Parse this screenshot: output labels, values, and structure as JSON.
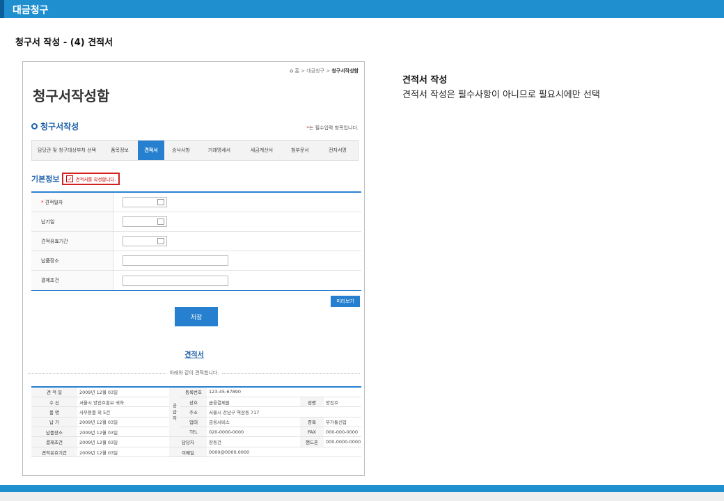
{
  "header": {
    "title": "대금청구"
  },
  "section_title": "청구서 작성 - (4) 견적서",
  "frame": {
    "breadcrumb": {
      "home": "홈",
      "sep": ">",
      "mid": "대금청구",
      "current": "청구서작성함"
    },
    "page_title": "청구서작성함",
    "sub_title": "청구서작성",
    "required_note_star": "*",
    "required_note": "는 필수입력 항목입니다.",
    "tabs": [
      {
        "label": "담당관 및 청구대상부처 선택"
      },
      {
        "label": "품목정보"
      },
      {
        "label": "견적서",
        "active": true
      },
      {
        "label": "승낙사항"
      },
      {
        "label": "거래명세서"
      },
      {
        "label": "세금계산서"
      },
      {
        "label": "첨부문서"
      },
      {
        "label": "전자서명"
      }
    ],
    "basic_info": {
      "label": "기본정보",
      "checkbox_mark": "✓",
      "checkbox_label": "견적서를 작성합니다."
    },
    "form": {
      "rows": [
        {
          "label": "견적일자",
          "required": true
        },
        {
          "label": "납기일"
        },
        {
          "label": "견적유효기간"
        },
        {
          "label": "납품장소"
        },
        {
          "label": "결제조건"
        }
      ]
    },
    "preview_button": "미리보기",
    "save_button": "저장",
    "estimate": {
      "title": "견적서",
      "subtitle": "아래와 같이 견적합니다.",
      "supplier_label": "공급자",
      "rows": [
        {
          "k1": "견 적 일",
          "v1": "2009년 12월 03일",
          "k2": "등록번호",
          "v2": "123-45-67890",
          "k3": "",
          "v3": ""
        },
        {
          "k1": "수 신",
          "v1": "서울시 양진호홍보 귀하",
          "k2": "상호",
          "v2": "금융결제원",
          "k3": "성명",
          "v3": "양진호"
        },
        {
          "k1": "품 명",
          "v1": "사무용품 외 5건",
          "k2": "주소",
          "v2": "서울시 강남구 역삼동 717",
          "k3": "",
          "v3": ""
        },
        {
          "k1": "납 기",
          "v1": "2009년 12월 03일",
          "k2": "업태",
          "v2": "금융서비스",
          "k3": "종목",
          "v3": "부가통신업"
        },
        {
          "k1": "납품장소",
          "v1": "2009년 12월 03일",
          "k2": "TEL",
          "v2": "020-0000-0000",
          "k3": "FAX",
          "v3": "000-000-0000"
        },
        {
          "k1": "결제조건",
          "v1": "2009년 12월 03일",
          "k2": "담당자",
          "v2": "장동건",
          "k3": "핸드폰",
          "v3": "000-0000-0000"
        },
        {
          "k1": "견적유효기간",
          "v1": "2009년 12월 03일",
          "k2": "이메일",
          "v2": "0000@0000.0000",
          "k3": "",
          "v3": ""
        }
      ]
    }
  },
  "side": {
    "title": "견적서 작성",
    "description": "견적서 작성은 필수사항이 아니므로 필요시에만 선택"
  }
}
